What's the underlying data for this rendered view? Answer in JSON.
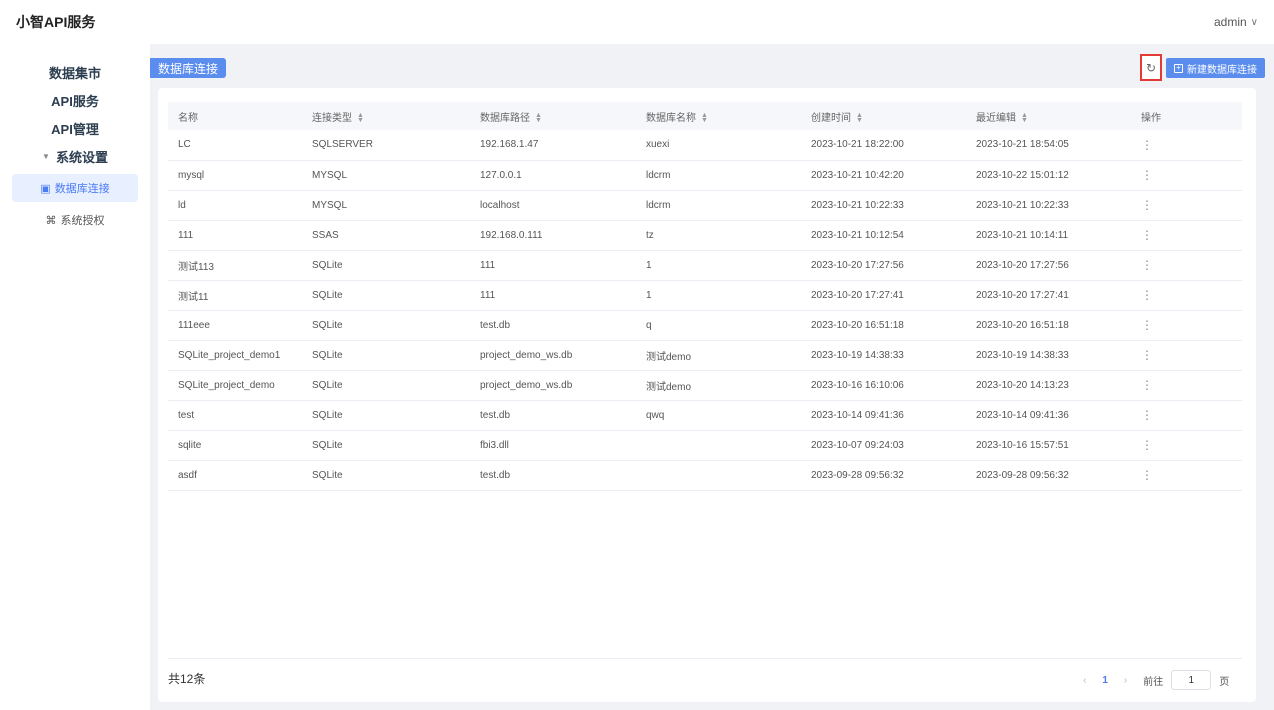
{
  "header": {
    "brand": "小智API服务",
    "user": "admin"
  },
  "sidebar": {
    "items": [
      "数据集市",
      "API服务",
      "API管理"
    ],
    "group": "系统设置",
    "sub_items": [
      {
        "label": "数据库连接",
        "active": true
      },
      {
        "label": "系统授权",
        "active": false
      }
    ]
  },
  "page": {
    "tag": "数据库连接",
    "new_button": "新建数据库连接"
  },
  "table": {
    "columns": [
      "名称",
      "连接类型",
      "数据库路径",
      "数据库名称",
      "创建时间",
      "最近编辑",
      "操作"
    ],
    "rows": [
      [
        "LC",
        "SQLSERVER",
        "192.168.1.47",
        "xuexi",
        "2023-10-21 18:22:00",
        "2023-10-21 18:54:05"
      ],
      [
        "mysql",
        "MYSQL",
        "127.0.0.1",
        "ldcrm",
        "2023-10-21 10:42:20",
        "2023-10-22 15:01:12"
      ],
      [
        "ld",
        "MYSQL",
        "localhost",
        "ldcrm",
        "2023-10-21 10:22:33",
        "2023-10-21 10:22:33"
      ],
      [
        "111",
        "SSAS",
        "192.168.0.111",
        "tz",
        "2023-10-21 10:12:54",
        "2023-10-21 10:14:11"
      ],
      [
        "测试113",
        "SQLite",
        "111",
        "1",
        "2023-10-20 17:27:56",
        "2023-10-20 17:27:56"
      ],
      [
        "测试11",
        "SQLite",
        "111",
        "1",
        "2023-10-20 17:27:41",
        "2023-10-20 17:27:41"
      ],
      [
        "111eee",
        "SQLite",
        "test.db",
        "q",
        "2023-10-20 16:51:18",
        "2023-10-20 16:51:18"
      ],
      [
        "SQLite_project_demo1",
        "SQLite",
        "project_demo_ws.db",
        "测试demo",
        "2023-10-19 14:38:33",
        "2023-10-19 14:38:33"
      ],
      [
        "SQLite_project_demo",
        "SQLite",
        "project_demo_ws.db",
        "测试demo",
        "2023-10-16 16:10:06",
        "2023-10-20 14:13:23"
      ],
      [
        "test",
        "SQLite",
        "test.db",
        "qwq",
        "2023-10-14 09:41:36",
        "2023-10-14 09:41:36"
      ],
      [
        "sqlite",
        "SQLite",
        "fbi3.dll",
        "",
        "2023-10-07 09:24:03",
        "2023-10-16 15:57:51"
      ],
      [
        "asdf",
        "SQLite",
        "test.db",
        "",
        "2023-09-28 09:56:32",
        "2023-09-28 09:56:32"
      ]
    ]
  },
  "footer": {
    "total": "共12条",
    "current_page": "1",
    "goto_label": "前往",
    "goto_value": "1",
    "page_suffix": "页"
  }
}
